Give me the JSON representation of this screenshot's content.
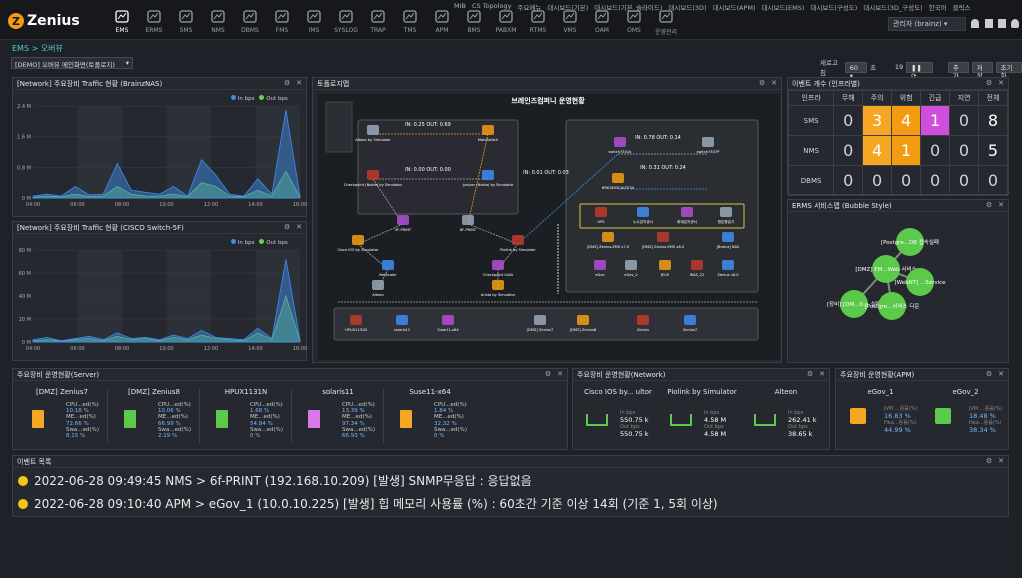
{
  "app": {
    "logo": "Zenius",
    "breadcrumb": "EMS > 오버뷰"
  },
  "nav": [
    {
      "label": "EMS",
      "icon": "monitor-icon",
      "active": true
    },
    {
      "label": "ERMS",
      "icon": "network-icon"
    },
    {
      "label": "SMS",
      "icon": "server-icon"
    },
    {
      "label": "NMS",
      "icon": "topology-icon"
    },
    {
      "label": "DBMS",
      "icon": "database-icon"
    },
    {
      "label": "FMS",
      "icon": "chip-icon"
    },
    {
      "label": "IMS",
      "icon": "globe-icon"
    },
    {
      "label": "SYSLOG",
      "icon": "document-icon"
    },
    {
      "label": "TRAP",
      "icon": "wave-icon"
    },
    {
      "label": "TMS",
      "icon": "terminal-icon"
    },
    {
      "label": "APM",
      "icon": "app-icon"
    },
    {
      "label": "BMS",
      "icon": "download-icon"
    },
    {
      "label": "PABXM",
      "icon": "pabx-icon"
    },
    {
      "label": "RTMS",
      "icon": "clock-icon"
    },
    {
      "label": "VMS",
      "icon": "cloud-icon"
    },
    {
      "label": "OAM",
      "icon": "chart-icon"
    },
    {
      "label": "OMS",
      "icon": "screen-icon"
    },
    {
      "label": "운영관리",
      "icon": "gear-icon"
    }
  ],
  "toplinks": [
    "MIB",
    "CS Topology",
    "주요메뉴",
    "대시보드(기본)",
    "대시보드(기본_슬라이드)",
    "대시보드(3D)",
    "대시보드(APM)",
    "대시보드(EMS)",
    "대시보드(구성도)",
    "대시보드(3D_구성도)",
    "한국어",
    "클릭스"
  ],
  "user": "관리자 (brainz)",
  "controls": {
    "dashboard": "[DEMO] 오버뷰 메인화면(토폴로지)",
    "refresh_label": "새로고침",
    "refresh_value": "60",
    "sec_label": "초",
    "countdown": "19",
    "add": "추가",
    "save": "저장",
    "reset": "초기화"
  },
  "traffic1": {
    "title": "[Network] 주요장비 Traffic 현황 (BrainzNAS)",
    "legend_in": "In bps",
    "legend_out": "Out bps"
  },
  "traffic2": {
    "title": "[Network] 주요장비 Traffic 현황 (CISCO Switch-5F)",
    "legend_in": "In bps",
    "legend_out": "Out bps"
  },
  "chart_data": [
    {
      "type": "line",
      "x": [
        "04:00",
        "06:00",
        "08:00",
        "10:00",
        "12:00",
        "14:00",
        "16:00"
      ],
      "yticks": [
        "0 M",
        "0.8 M",
        "1.6 M",
        "2.4 M"
      ],
      "ylim": [
        0,
        2.4
      ],
      "series": [
        {
          "name": "In bps",
          "color": "#3d8df0",
          "values": [
            0.05,
            0.1,
            0.05,
            0.3,
            0.08,
            0.1,
            0.9,
            0.2,
            0.15,
            0.1,
            0.3,
            0.05,
            1.0,
            0.6,
            0.1,
            0.05,
            0.5,
            0.1,
            2.3,
            0.05
          ]
        },
        {
          "name": "Out bps",
          "color": "#6bd35a",
          "values": [
            0.02,
            0.05,
            0.03,
            0.1,
            0.04,
            0.05,
            0.3,
            0.1,
            0.05,
            0.05,
            0.1,
            0.03,
            0.4,
            0.3,
            0.05,
            0.03,
            0.2,
            0.05,
            0.7,
            0.03
          ]
        }
      ]
    },
    {
      "type": "line",
      "x": [
        "04:00",
        "06:00",
        "08:00",
        "10:00",
        "12:00",
        "14:00",
        "16:00"
      ],
      "yticks": [
        "0 M",
        "20 M",
        "40 M",
        "60 M",
        "80 M"
      ],
      "ylim": [
        0,
        80
      ],
      "series": [
        {
          "name": "In bps",
          "color": "#3d8df0",
          "values": [
            2,
            4,
            1,
            3,
            5,
            2,
            8,
            3,
            4,
            2,
            6,
            3,
            10,
            4,
            3,
            2,
            12,
            3,
            72,
            2
          ]
        },
        {
          "name": "Out bps",
          "color": "#6bd35a",
          "values": [
            1,
            2,
            1,
            2,
            3,
            1,
            5,
            2,
            3,
            1,
            4,
            2,
            6,
            3,
            2,
            1,
            8,
            2,
            40,
            1
          ]
        }
      ]
    }
  ],
  "topology": {
    "title": "토폴로지맵",
    "banner": "브레인즈컴퍼니 운영현황",
    "links": [
      {
        "label": "IN: 0.25 OUT: 0.69"
      },
      {
        "label": "IN: 0.00 OUT: 0.00"
      },
      {
        "label": "IN: 0.01 OUT: 0.03"
      },
      {
        "label": "IN: 0.78 OUT: 0.14"
      },
      {
        "label": "IN: 0.31 OUT: 0.24"
      }
    ],
    "nodes": [
      "Alteon by Simulator",
      "MainSwitch",
      "Checkpoint (Nokia) by Simulator",
      "Juniper (Nokia) by Simulator",
      "5F-PRINT",
      "6F-PRINT",
      "Cisco IOS by Simulator",
      "Piolink by Simulator",
      "NetScaler",
      "Checkpoint GAIA",
      "Alteon",
      "Arista by Simulator",
      "HPUX1131N",
      "solaris11",
      "Suse11-x64",
      "[DMZ] Zenius7",
      "[DMZ] Zenius8",
      "Zenius",
      "Zenius7",
      "switch7551b",
      "switch7537P",
      "BRK3655CALTE3A",
      "UPS",
      "누수감지센서",
      "화재감지센서",
      "항온항습기",
      "[DMZ] Zenius-EMS v7.0",
      "[DMZ] Zenius-EMS v8.0",
      "[Brainz] NAS",
      "eGov",
      "eGov_2",
      "JEUS",
      "WAS_22",
      "Zenius v8.0"
    ]
  },
  "events": {
    "title": "이벤트 개수 (인프라별)",
    "headers": [
      "인프라",
      "무해",
      "주의",
      "위험",
      "긴급",
      "지연",
      "전체"
    ],
    "rows": [
      {
        "name": "SMS",
        "values": [
          "0",
          "3",
          "4",
          "1",
          "0",
          "8"
        ]
      },
      {
        "name": "NMS",
        "values": [
          "0",
          "4",
          "1",
          "0",
          "0",
          "5"
        ]
      },
      {
        "name": "DBMS",
        "values": [
          "0",
          "0",
          "0",
          "0",
          "0",
          "0"
        ]
      }
    ]
  },
  "bubble": {
    "title": "ERMS 서비스맵 (Bubble Style)",
    "labels": [
      "[Postgre...DB 접속실패",
      "[DMZ] EM...Web 서비스",
      "[WebNT] ...Service",
      "[장비] [DM...0 > 실패",
      "[Postgre...서비스 다운"
    ]
  },
  "servers": {
    "title": "주요장비 운영현황(Server)",
    "items": [
      {
        "name": "[DMZ] Zenius7",
        "color": "#f5a623",
        "cpu": "10.18 %",
        "mem": "72.66 %",
        "swap": "8.15 %"
      },
      {
        "name": "[DMZ] Zenius8",
        "color": "#5cc94a",
        "cpu": "10.06 %",
        "mem": "66.99 %",
        "swap": "2.19 %"
      },
      {
        "name": "HPUX1131N",
        "color": "#5cc94a",
        "cpu": "1.68 %",
        "mem": "54.84 %",
        "swap": "0 %"
      },
      {
        "name": "solaris11",
        "color": "#d978e8",
        "cpu": "13.39 %",
        "mem": "97.34 %",
        "swap": "66.93 %"
      },
      {
        "name": "Suse11-x64",
        "color": "#f5a623",
        "cpu": "1.84 %",
        "mem": "32.32 %",
        "swap": "0 %"
      }
    ],
    "labels": {
      "cpu": "CPU...ed(%)",
      "mem": "ME...ed(%)",
      "swap": "Swa...ed(%)"
    }
  },
  "network": {
    "title": "주요장비 운영현황(Network)",
    "items": [
      {
        "name": "Cisco IOS by... ultor",
        "in": "550.75 k",
        "out": "550.75 k"
      },
      {
        "name": "Piolink by Simulator",
        "in": "4.58 M",
        "out": "4.58 M"
      },
      {
        "name": "Alteon",
        "in": "262.41 k",
        "out": "38.65 k"
      }
    ],
    "labels": {
      "in": "In bps",
      "out": "Out bps"
    }
  },
  "apm": {
    "title": "주요장비 운영현황(APM)",
    "items": [
      {
        "name": "eGov_1",
        "color": "#f5a623",
        "jvm": "16.83 %",
        "heap": "44.99 %"
      },
      {
        "name": "eGov_2",
        "color": "#5cc94a",
        "jvm": "18.48 %",
        "heap": "38.34 %"
      }
    ],
    "labels": {
      "jvm": "JVM ...용률(%)",
      "heap": "Hea...용률(%)"
    }
  },
  "eventlist": {
    "title": "이벤트 목록",
    "items": [
      "2022-06-28 09:49:45 NMS > 6f-PRINT (192.168.10.209) [발생] SNMP무응답 : 응답없음",
      "2022-06-28 09:10:40 APM > eGov_1 (10.0.10.225) [발생] 힙 메모리 사용률 (%) : 60초간 기준 이상 14회 (기준 1, 5회 이상)"
    ]
  }
}
